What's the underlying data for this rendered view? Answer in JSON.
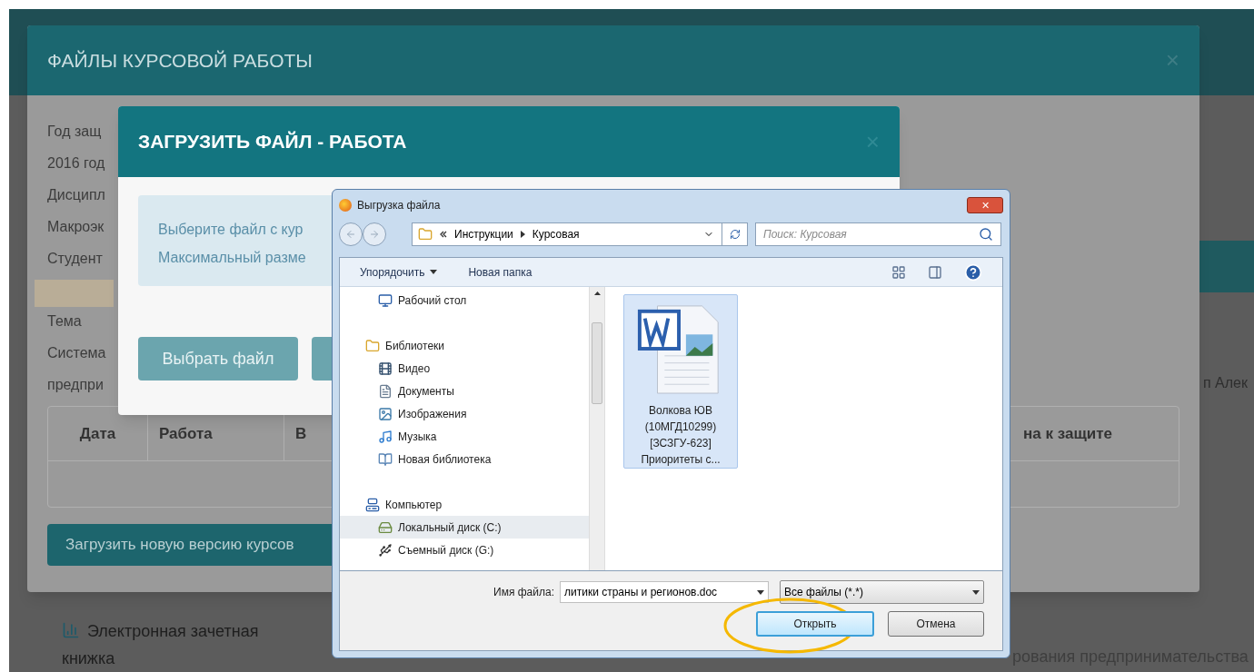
{
  "background_page": {
    "side_text": "п Алек",
    "nav_link": [
      "Электронная зачетная",
      "книжка"
    ],
    "footer_text": "рования предпринимательства"
  },
  "course_files_modal": {
    "title": "ФАЙЛЫ КУРСОВОЙ РАБОТЫ",
    "close": "×",
    "fields": [
      {
        "text": "Год защ"
      },
      {
        "text": "2016 год"
      },
      {
        "text": "Дисципл"
      },
      {
        "text": "Макроэк"
      },
      {
        "text": "Студент"
      },
      {
        "kind": "redacted"
      },
      {
        "text": "Тема"
      },
      {
        "text": "Система"
      },
      {
        "text": "предпри"
      }
    ],
    "table": {
      "columns": [
        "Дата",
        "Работа",
        "В",
        "на к защите"
      ]
    },
    "upload_button": "Загрузить новую версию курсов"
  },
  "upload_modal": {
    "title": "ЗАГРУЗИТЬ ФАЙЛ - РАБОТА",
    "close": "×",
    "info_lines": [
      "Выберите файл с кур",
      "Максимальный разме"
    ],
    "choose_button": "Выбрать файл"
  },
  "file_dialog": {
    "title": "Выгрузка файла",
    "close": "✕",
    "breadcrumb": [
      "Инструкции",
      "Курсовая"
    ],
    "search": {
      "placeholder": "Поиск: Курсовая"
    },
    "toolbar": [
      "Упорядочить",
      "Новая папка"
    ],
    "nav": [
      {
        "label": "Рабочий стол",
        "kind": "desktop",
        "selected": false
      },
      {
        "label": "Библиотеки",
        "kind": "libraries",
        "selected": false,
        "children": [
          {
            "label": "Видео",
            "kind": "video",
            "selected": false
          },
          {
            "label": "Документы",
            "kind": "documents",
            "selected": false
          },
          {
            "label": "Изображения",
            "kind": "images",
            "selected": false
          },
          {
            "label": "Музыка",
            "kind": "music",
            "selected": false
          },
          {
            "label": "Новая библиотека",
            "kind": "library",
            "selected": false
          }
        ]
      },
      {
        "label": "Компьютер",
        "kind": "computer",
        "selected": false,
        "children": [
          {
            "label": "Локальный диск (C:)",
            "kind": "disk",
            "selected": true
          },
          {
            "label": "Съемный диск (G:)",
            "kind": "removable",
            "selected": false
          }
        ]
      }
    ],
    "files": [
      {
        "name_lines": [
          "Волкова ЮВ",
          "(10МГД10299)",
          "[ЗСЗГУ-623]",
          "Приоритеты с..."
        ],
        "selected": true
      }
    ],
    "filename_label": "Имя файла:",
    "filename_value": "литики страны и регионов.doc",
    "filter": "Все файлы (*.*)",
    "buttons": [
      {
        "label": "Открыть",
        "default": true,
        "highlighted": true
      },
      {
        "label": "Отмена",
        "default": false,
        "highlighted": false
      }
    ]
  }
}
